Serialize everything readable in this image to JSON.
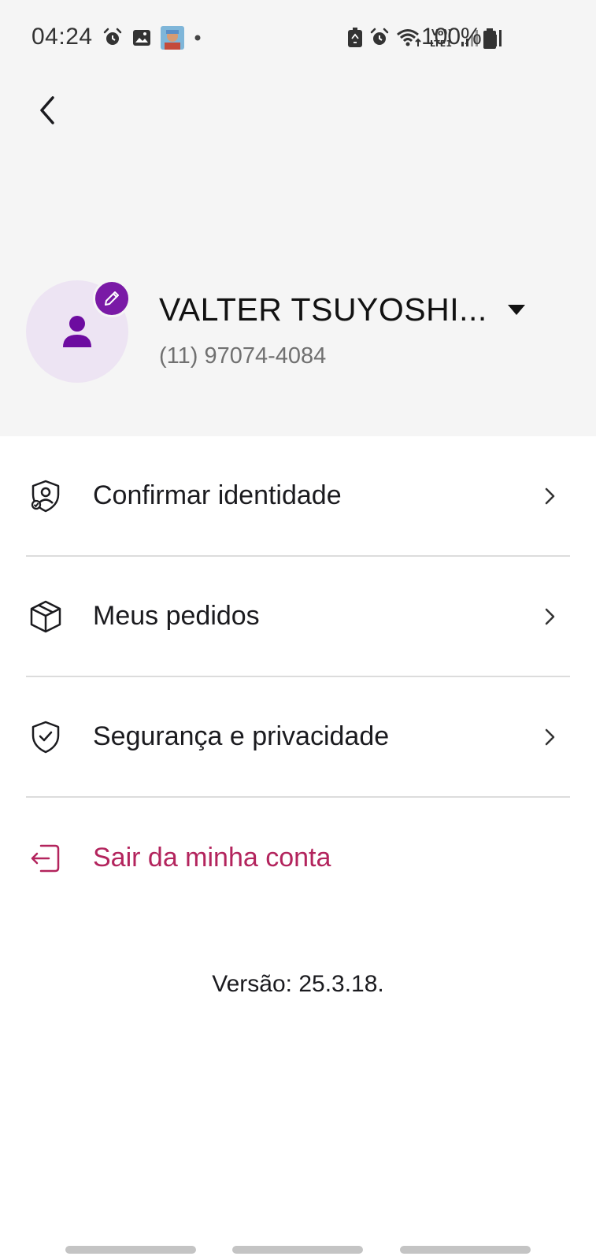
{
  "status_bar": {
    "time": "04:24",
    "battery": "100%",
    "signal_label": "Vo)) LTE1",
    "icons": [
      "alarm-icon",
      "image-icon",
      "app-avatar-icon",
      "notification-dot-icon",
      "battery-saver-icon",
      "alarm-icon",
      "wifi-icon",
      "volte-icon",
      "signal-icon",
      "signal-icon",
      "battery-icon"
    ]
  },
  "header": {
    "back_icon": "chevron-left-icon"
  },
  "profile": {
    "name": "VALTER TSUYOSHI...",
    "phone": "(11) 97074-4084",
    "avatar_icon": "person-icon",
    "edit_icon": "pencil-icon",
    "accent_color": "#7a1aa6",
    "avatar_bg": "#ede4f3"
  },
  "menu": {
    "items": [
      {
        "label": "Confirmar identidade",
        "icon": "identity-shield-icon"
      },
      {
        "label": "Meus pedidos",
        "icon": "package-icon"
      },
      {
        "label": "Segurança e privacidade",
        "icon": "shield-check-icon"
      }
    ],
    "logout": {
      "label": "Sair da minha conta",
      "icon": "logout-icon",
      "color": "#b3245d"
    }
  },
  "footer": {
    "version": "Versão: 25.3.18."
  }
}
